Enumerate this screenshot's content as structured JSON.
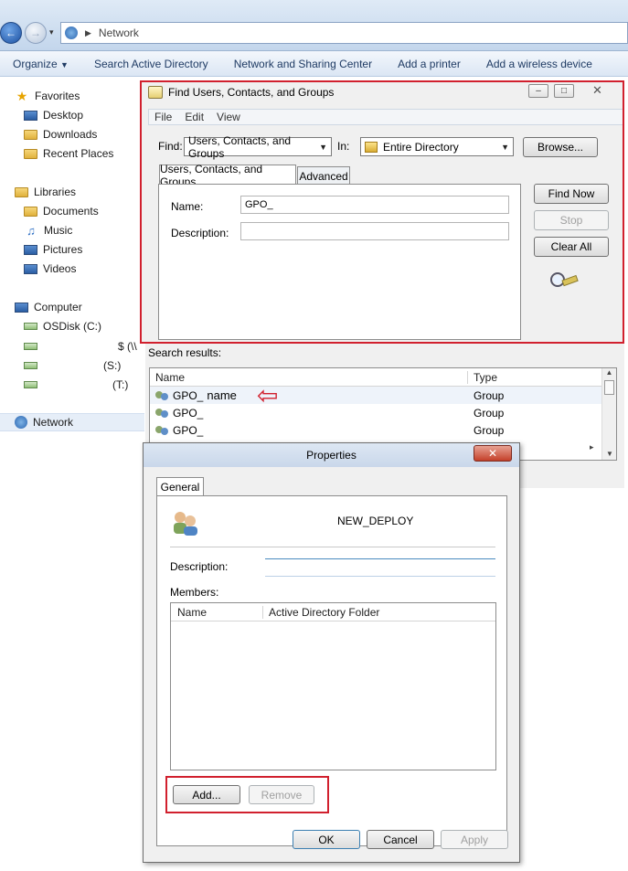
{
  "explorer": {
    "address": "Network",
    "toolbar": [
      "Organize",
      "Search Active Directory",
      "Network and Sharing Center",
      "Add a printer",
      "Add a wireless device"
    ],
    "nav": {
      "favorites": "Favorites",
      "desktop": "Desktop",
      "downloads": "Downloads",
      "recent": "Recent Places",
      "libraries": "Libraries",
      "documents": "Documents",
      "music": "Music",
      "pictures": "Pictures",
      "videos": "Videos",
      "computer": "Computer",
      "osdisk": "OSDisk (C:)",
      "drive1": "$ (\\\\",
      "drive2": "(S:)",
      "drive3": "(T:)",
      "network": "Network"
    }
  },
  "find": {
    "title": "Find Users, Contacts, and Groups",
    "menu": [
      "File",
      "Edit",
      "View"
    ],
    "find_label": "Find:",
    "find_value": "Users, Contacts, and Groups",
    "in_label": "In:",
    "in_value": "Entire Directory",
    "browse": "Browse...",
    "tab_main": "Users, Contacts, and Groups",
    "tab_adv": "Advanced",
    "name_label": "Name:",
    "name_value": "GPO_",
    "desc_label": "Description:",
    "desc_value": "",
    "find_now": "Find Now",
    "stop": "Stop",
    "clear_all": "Clear All"
  },
  "results": {
    "label": "Search results:",
    "col_name": "Name",
    "col_type": "Type",
    "rows": [
      {
        "name": "GPO_",
        "annot": "name",
        "type": "Group"
      },
      {
        "name": "GPO_",
        "type": "Group"
      },
      {
        "name": "GPO_",
        "type": "Group"
      }
    ]
  },
  "props": {
    "title": "Properties",
    "tab": "General",
    "group_name": "NEW_DEPLOY",
    "desc_label": "Description:",
    "members_label": "Members:",
    "col_name": "Name",
    "col_folder": "Active Directory Folder",
    "add": "Add...",
    "remove": "Remove",
    "ok": "OK",
    "cancel": "Cancel",
    "apply": "Apply"
  },
  "colors": {
    "highlight": "#d1202e",
    "accent": "#1e3a63"
  }
}
